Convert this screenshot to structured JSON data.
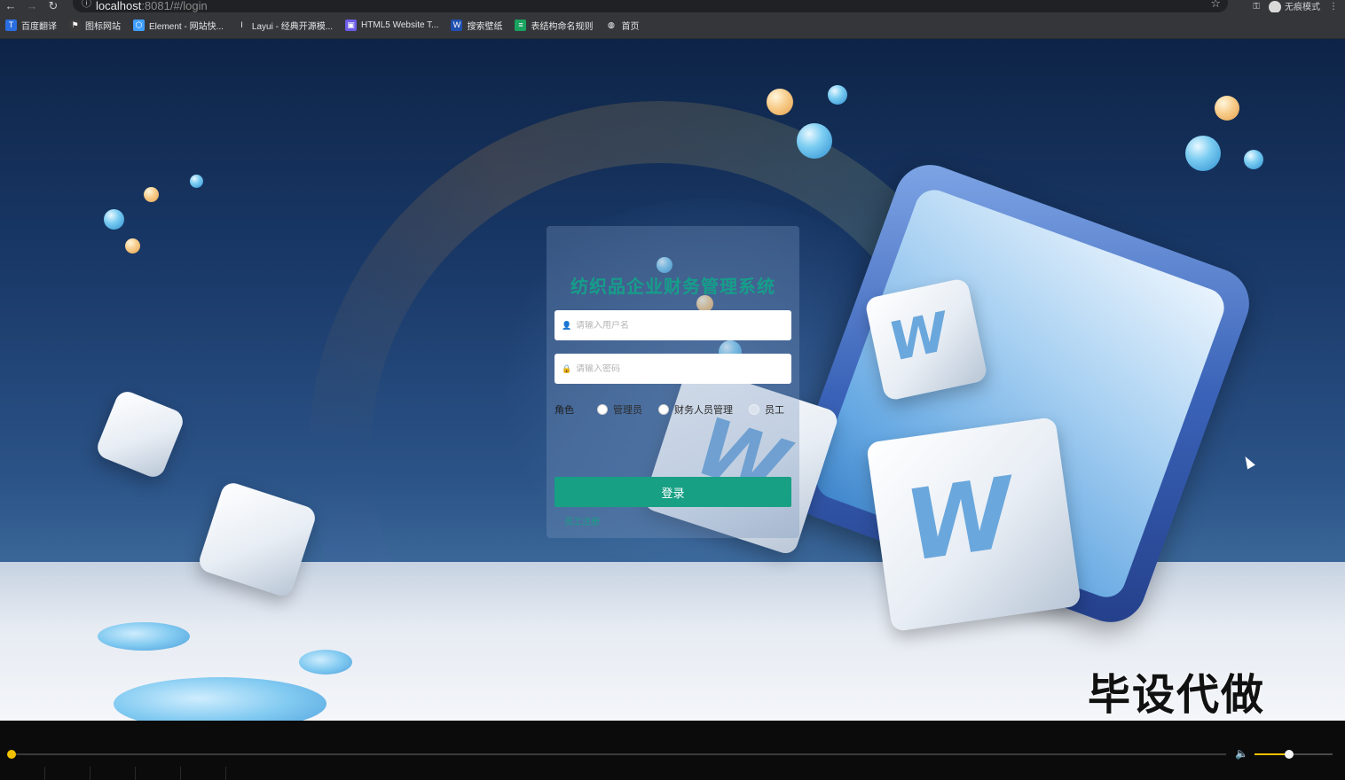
{
  "browser": {
    "url_host": "localhost",
    "url_rest": ":8081/#/login",
    "incognito_label": "无痕模式",
    "bookmarks": [
      {
        "label": "百度翻译",
        "color": "#2a6de0",
        "glyph": "T"
      },
      {
        "label": "图标网站",
        "color": "#3a3a3a",
        "glyph": "⚑"
      },
      {
        "label": "Element - 网站快...",
        "color": "#409eff",
        "glyph": "⬡"
      },
      {
        "label": "Layui - 经典开源模...",
        "color": "#35363a",
        "glyph": "l"
      },
      {
        "label": "HTML5 Website T...",
        "color": "#6c5ce7",
        "glyph": "▣"
      },
      {
        "label": "搜索壁纸",
        "color": "#1f4fb0",
        "glyph": "W"
      },
      {
        "label": "表结构命名规则",
        "color": "#1aa260",
        "glyph": "≡"
      },
      {
        "label": "首页",
        "color": "#35363a",
        "glyph": "◍"
      }
    ]
  },
  "login": {
    "title": "纺织品企业财务管理系统",
    "username_placeholder": "请输入用户名",
    "password_placeholder": "请输入密码",
    "role_label": "角色",
    "roles": [
      "管理员",
      "财务人员管理",
      "员工"
    ],
    "submit_label": "登录",
    "register_link": "员工注册"
  },
  "watermark": "毕设代做",
  "player": {
    "progress": 0.0,
    "volume": 0.44
  }
}
